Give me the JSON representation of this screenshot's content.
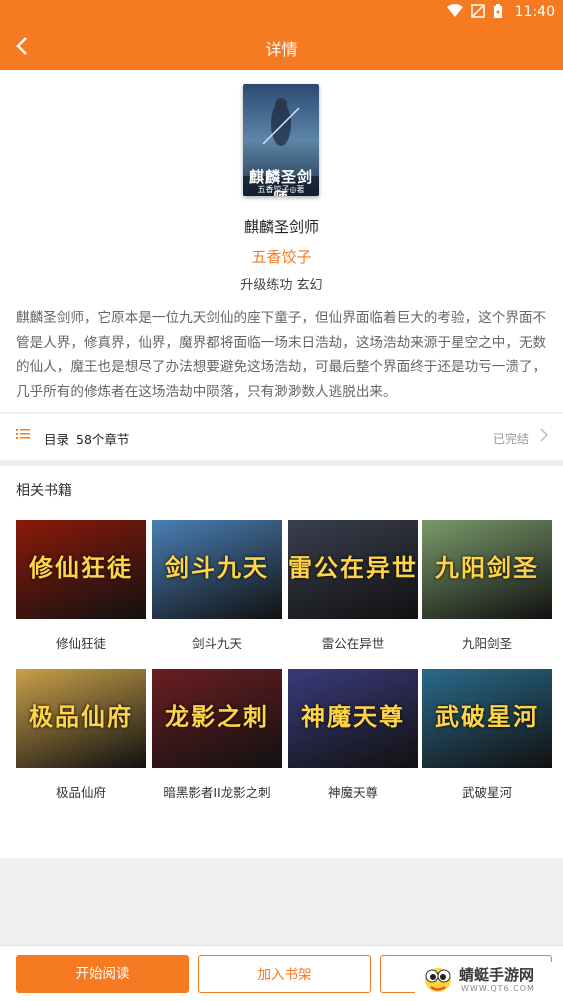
{
  "status_bar": {
    "time": "11:40",
    "wifi_icon": "wifi-icon",
    "signal_icon": "signal-off-icon",
    "battery_icon": "battery-charging-icon"
  },
  "header": {
    "title": "详情",
    "back_icon": "chevron-left-icon"
  },
  "book": {
    "cover": {
      "title": "麒麟圣剑师",
      "author": "五香饺子◎著"
    },
    "title": "麒麟圣剑师",
    "author": "五香饺子",
    "tags": "升级练功  玄幻",
    "description": "麒麟圣剑师，它原本是一位九天剑仙的座下童子，但仙界面临着巨大的考验，这个界面不管是人界，修真界，仙界，魔界都将面临一场末日浩劫，这场浩劫来源于星空之中，无数的仙人，魔王也是想尽了办法想要避免这场浩劫，可最后整个界面终于还是功亏一溃了，几乎所有的修炼者在这场浩劫中陨落，只有渺渺数人逃脱出来。"
  },
  "catalog": {
    "icon": "list-icon",
    "label": "目录",
    "count": "58个章节",
    "status": "已完结"
  },
  "related": {
    "heading": "相关书籍",
    "books": [
      {
        "name": "修仙狂徒",
        "cover_text": "修仙狂徒",
        "bg": "#8b1a0a"
      },
      {
        "name": "剑斗九天",
        "cover_text": "剑斗九天",
        "bg": "#4a7fb5"
      },
      {
        "name": "雷公在异世",
        "cover_text": "雷公在异世",
        "bg": "#3a3f4f"
      },
      {
        "name": "九阳剑圣",
        "cover_text": "九阳剑圣",
        "bg": "#7a9a6a"
      },
      {
        "name": "极品仙府",
        "cover_text": "极品仙府",
        "bg": "#c9a04a"
      },
      {
        "name": "暗黑影者II龙影之刺",
        "cover_text": "龙影之刺",
        "bg": "#6a1e22"
      },
      {
        "name": "神魔天尊",
        "cover_text": "神魔天尊",
        "bg": "#3a3a7a"
      },
      {
        "name": "武破星河",
        "cover_text": "武破星河",
        "bg": "#2a6a8a"
      }
    ]
  },
  "bottom": {
    "read_label": "开始阅读",
    "shelf_label": "加入书架",
    "third_label": ""
  },
  "watermark": {
    "text": "蜻蜓手游网",
    "url": "WWW.QT6.COM"
  },
  "colors": {
    "accent": "#f57a21",
    "background": "#efefef"
  }
}
